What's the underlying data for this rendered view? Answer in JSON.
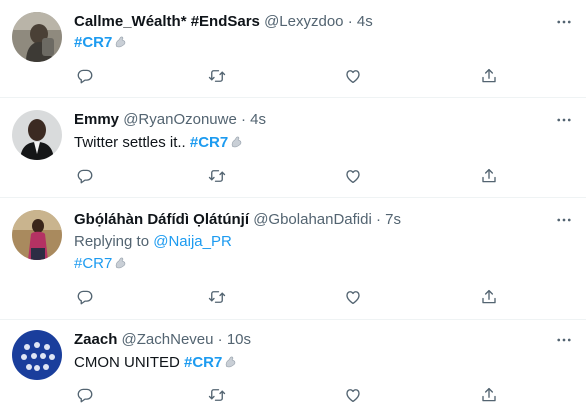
{
  "colors": {
    "link": "#1d9bf0",
    "meta": "#536471",
    "text": "#0f1419",
    "divider": "#eff3f4"
  },
  "icons": [
    "reply-icon",
    "retweet-icon",
    "like-icon",
    "share-icon",
    "more-icon",
    "flexed-arm-emoji"
  ],
  "tweets": [
    {
      "name": "Callme_Wéalth* #EndSars",
      "handle": "@Lexyzdoo",
      "dot": "·",
      "time": "4s",
      "hashtag": "#CR7"
    },
    {
      "name": "Emmy",
      "handle": "@RyanOzonuwe",
      "dot": "·",
      "time": "4s",
      "text": "Twitter settles it..",
      "hashtag": "#CR7"
    },
    {
      "name": "Gbọ́láhàn Dáfídì Ọlátúnjí",
      "handle": "@GbolahanDafidi",
      "dot": "·",
      "time": "7s",
      "reply_prefix": "Replying to",
      "reply_to": "@Naija_PR",
      "hashtag": "#CR7"
    },
    {
      "name": "Zaach",
      "handle": "@ZachNeveu",
      "dot": "·",
      "time": "10s",
      "text": "CMON UNITED",
      "hashtag": "#CR7"
    }
  ]
}
